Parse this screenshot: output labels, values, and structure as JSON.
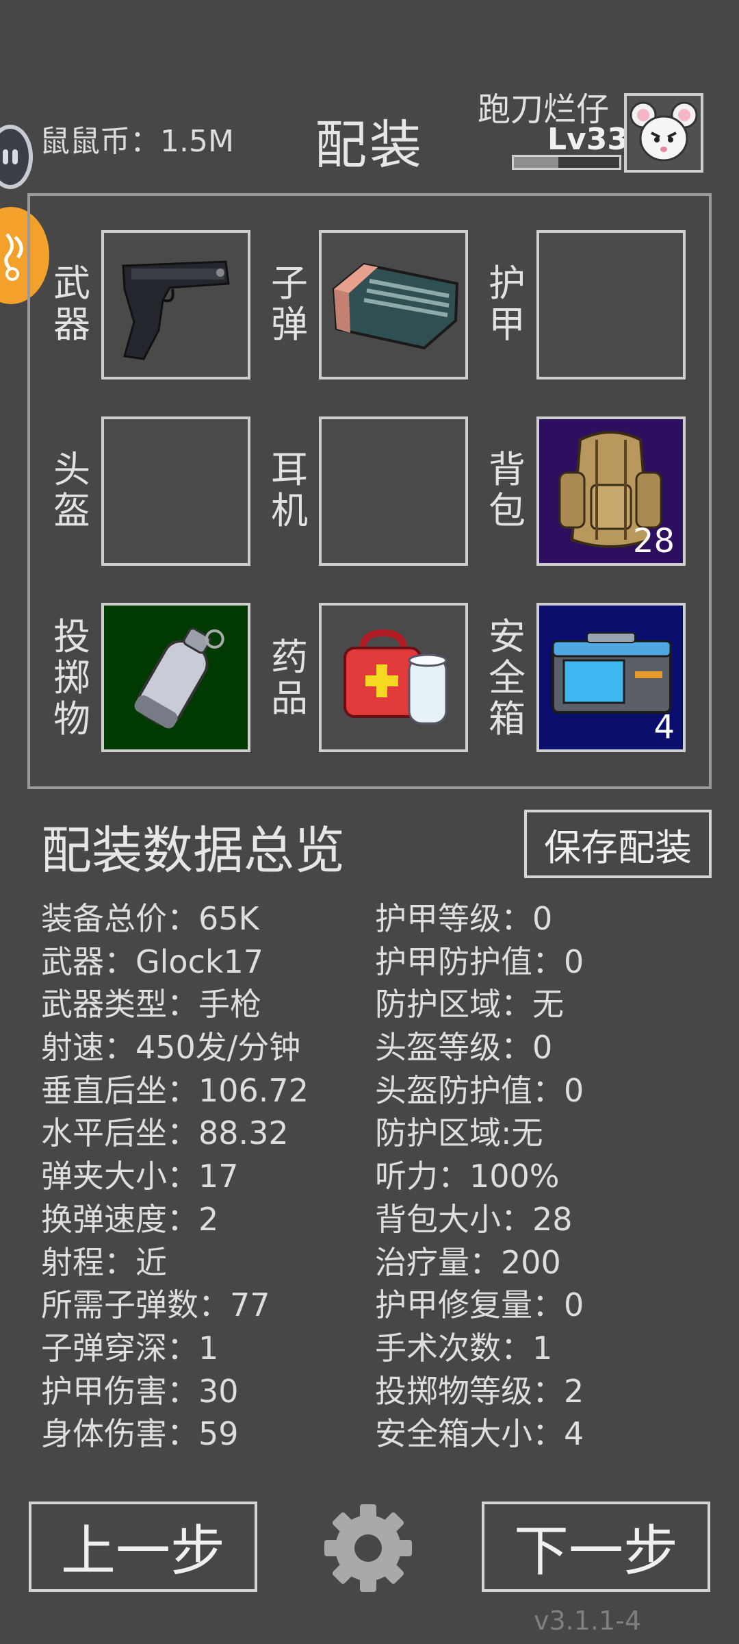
{
  "header": {
    "coins": "鼠鼠币：1.5M",
    "title": "配装",
    "username": "跑刀烂仔",
    "level": "Lv33",
    "xp_fraction": 0.42
  },
  "slots": [
    {
      "label": "武\n器",
      "item": "pistol-icon",
      "count": ""
    },
    {
      "label": "子\n弹",
      "item": "ammo-box-icon",
      "count": ""
    },
    {
      "label": "护\n甲",
      "item": "",
      "count": ""
    },
    {
      "label": "头\n盔",
      "item": "",
      "count": ""
    },
    {
      "label": "耳\n机",
      "item": "",
      "count": ""
    },
    {
      "label": "背\n包",
      "item": "backpack-icon",
      "count": "28"
    },
    {
      "label": "投\n掷\n物",
      "item": "grenade-icon",
      "count": ""
    },
    {
      "label": "药\n品",
      "item": "medkit-icon",
      "count": ""
    },
    {
      "label": "安\n全\n箱",
      "item": "safe-box-icon",
      "count": "4"
    }
  ],
  "colors": {
    "background": "#474747",
    "grenade_bg": "#003a00",
    "backpack_bg": "#2c0f5e",
    "safe_bg": "#0a0f6e"
  },
  "overview": {
    "title": "配装数据总览",
    "save_label": "保存配装"
  },
  "stats_left": [
    "装备总价：65K",
    "武器：Glock17",
    "武器类型：手枪",
    "射速：450发/分钟",
    "垂直后坐：106.72",
    "水平后坐：88.32",
    "弹夹大小：17",
    "换弹速度：2",
    "射程：近",
    "所需子弹数：77",
    "子弹穿深：1",
    "护甲伤害：30",
    "身体伤害：59"
  ],
  "stats_right": [
    "护甲等级：0",
    "护甲防护值：0",
    "防护区域：无",
    "头盔等级：0",
    "头盔防护值：0",
    "防护区域:无",
    "听力：100%",
    "背包大小：28",
    "治疗量：200",
    "护甲修复量：0",
    "手术次数：1",
    "投掷物等级：2",
    "安全箱大小：4"
  ],
  "footer": {
    "prev_label": "上一步",
    "next_label": "下一步",
    "settings_icon": "gear-icon",
    "version": "v3.1.1-4"
  }
}
